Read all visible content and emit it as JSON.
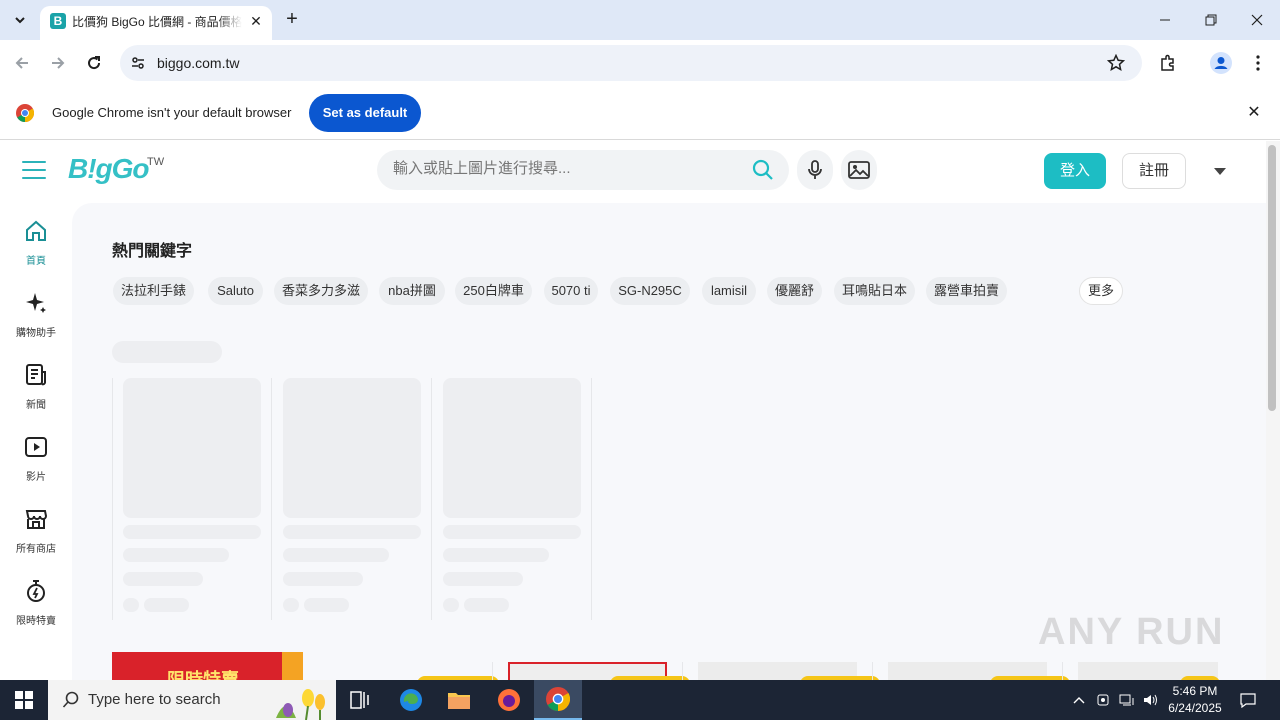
{
  "browser": {
    "tab_title": "比價狗 BigGo 比價網 - 商品價格",
    "favicon_letter": "B",
    "url": "biggo.com.tw"
  },
  "infobar": {
    "message": "Google Chrome isn't your default browser",
    "button": "Set as default"
  },
  "header": {
    "logo": "B!gGo",
    "logo_sup": "TW",
    "search_placeholder": "輸入或貼上圖片進行搜尋...",
    "login": "登入",
    "register": "註冊"
  },
  "sidebar": {
    "items": [
      {
        "label": "首頁",
        "icon": "home-icon"
      },
      {
        "label": "購物助手",
        "icon": "sparkle-icon"
      },
      {
        "label": "新聞",
        "icon": "news-icon"
      },
      {
        "label": "影片",
        "icon": "video-icon"
      },
      {
        "label": "所有商店",
        "icon": "store-icon"
      },
      {
        "label": "限時特賣",
        "icon": "stopwatch-icon"
      }
    ]
  },
  "main": {
    "hot_title": "熱門關鍵字",
    "keywords": [
      "法拉利手錶",
      "Saluto",
      "香菜多力多滋",
      "nba拼圖",
      "250白牌車",
      "5070 ti",
      "SG-N295C",
      "lamisil",
      "優麗舒",
      "耳鳴貼日本",
      "露營車拍賣"
    ],
    "more": "更多",
    "banner_text": "限時特賣"
  },
  "watermark": "ANY RUN",
  "taskbar": {
    "search_text": "Type here to search",
    "time": "5:46 PM",
    "date": "6/24/2025"
  },
  "colors": {
    "brand": "#1dbdc4",
    "chrome_blue": "#0b57d0",
    "taskbar": "#1c2535"
  }
}
